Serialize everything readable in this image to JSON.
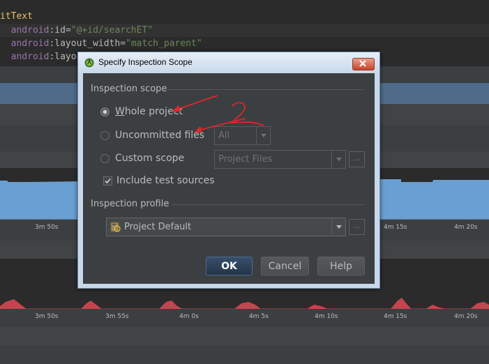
{
  "editor": {
    "lines": [
      {
        "tag": "itText"
      },
      {
        "ns": "android",
        "attr": "id",
        "value": "\"@+id/searchET\""
      },
      {
        "ns": "android",
        "attr": "layout_width",
        "value": "\"match_parent\""
      },
      {
        "ns": "android",
        "attr": "layou",
        "value": ""
      }
    ]
  },
  "timeline": {
    "upper_ticks": [
      "3m 50s",
      "4m 15s",
      "4m 20s"
    ],
    "lower_ticks": [
      "3m 50s",
      "3m 55s",
      "4m 0s",
      "4m 5s",
      "4m 10s",
      "4m 15s",
      "4m 20s"
    ],
    "colors": {
      "memory": "#6a9fd2",
      "cpu": "#c4454f"
    }
  },
  "dialog": {
    "title": "Specify Inspection Scope",
    "scope_section": "Inspection scope",
    "options": {
      "whole_project": "Whole project",
      "uncommitted_files": "Uncommitted files",
      "custom_scope": "Custom scope"
    },
    "selected_option": "whole_project",
    "changelist_combo": "All",
    "custom_scope_combo": "Project Files",
    "include_tests": {
      "label": "Include test sources",
      "checked": true
    },
    "ellipsis": "...",
    "profile_section": "Inspection profile",
    "profile_combo": "Project Default",
    "buttons": {
      "ok": "OK",
      "cancel": "Cancel",
      "help": "Help"
    },
    "annotation_digit": "2",
    "colors": {
      "accent_ok": "#2e4560",
      "annotation": "#e0262a"
    }
  }
}
